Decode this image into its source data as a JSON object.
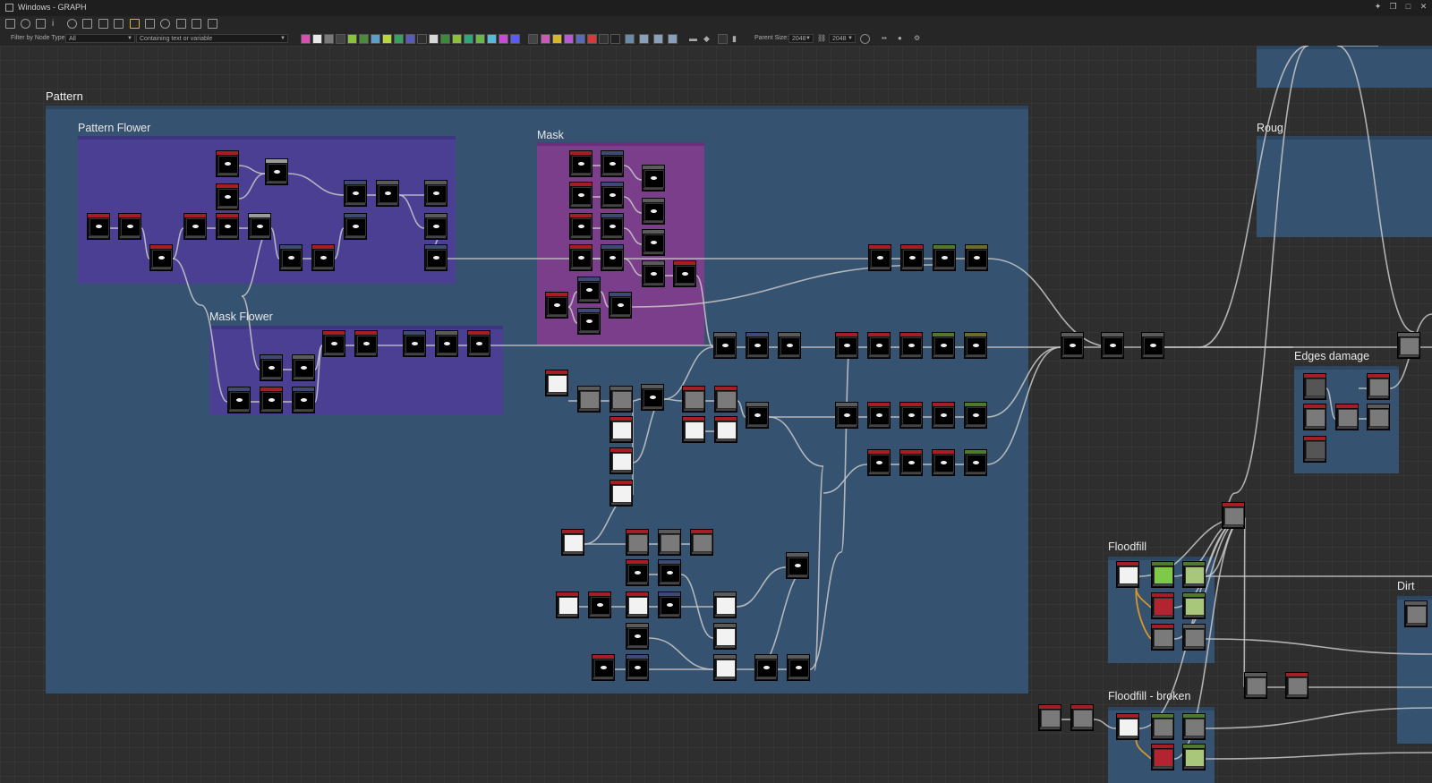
{
  "window": {
    "title": "Windows - GRAPH",
    "controls": [
      "pin",
      "float",
      "maximize",
      "close"
    ]
  },
  "toolbar_top": {
    "icons": [
      "frame-icon",
      "fit-icon",
      "camera-icon",
      "info-icon",
      "search-icon",
      "link-icon",
      "table-icon",
      "share-icon",
      "wire-icon",
      "align-icon",
      "loop-icon",
      "tool-icon",
      "select-icon",
      "crop-icon"
    ]
  },
  "toolbar_filter": {
    "filter_label": "Filter by Node Type",
    "filter_value": "All",
    "search_placeholder": "Containing text or variable",
    "parent_size_label": "Parent Size:",
    "parent_size_w": "2048",
    "parent_size_h": "2048"
  },
  "frames": {
    "pattern": "Pattern",
    "pattern_flower": "Pattern Flower",
    "mask": "Mask",
    "mask_flower": "Mask Flower",
    "roug": "Roug",
    "edges_damage": "Edges damage",
    "floodfill": "Floodfill",
    "floodfill_broken": "Floodfill - broken",
    "dirt": "Dirt"
  },
  "colors": {
    "frame_blue": "#355270",
    "frame_purple": "#4a3f93",
    "frame_mask": "#7a3e8a",
    "node_red": "#a51d25",
    "node_gray": "#5a5a5a",
    "node_olive": "#6b6b2a",
    "node_green": "#4f7a2a",
    "node_blue": "#3e4a73",
    "wire": "#c8c8c8",
    "wire_orange": "#d8962a"
  }
}
